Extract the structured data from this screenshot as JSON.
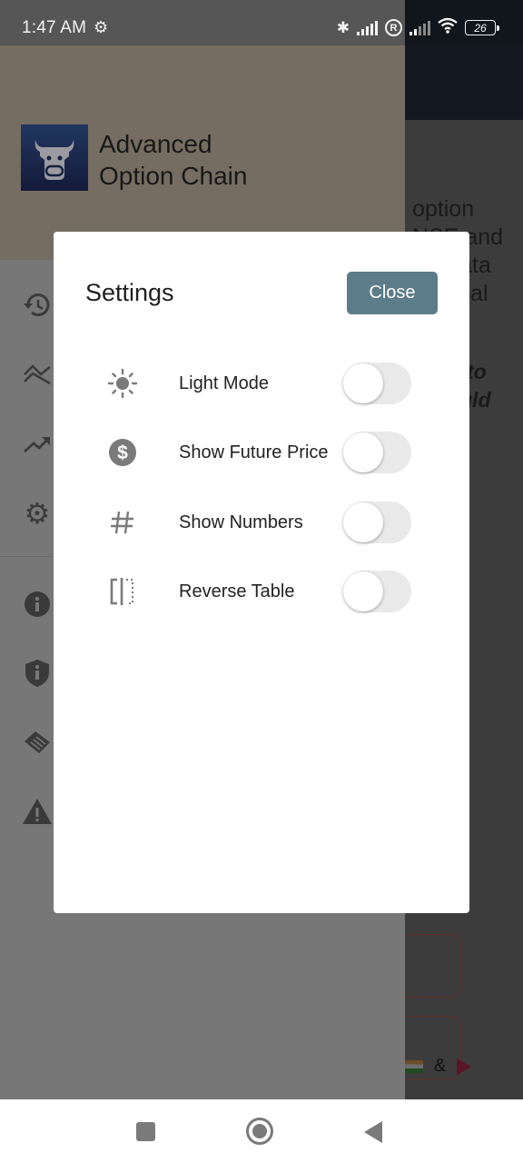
{
  "status_bar": {
    "time": "1:47 AM",
    "battery": "26",
    "icons": [
      "settings-gear-icon",
      "bluetooth-icon",
      "signal-icon",
      "registered-icon",
      "signal-icon-2",
      "wifi-icon",
      "battery-icon"
    ]
  },
  "drawer": {
    "app_name_line1": "Advanced",
    "app_name_line2": "Option Chain",
    "items": [
      {
        "icon": "history-icon"
      },
      {
        "icon": "chart-crossing-icon"
      },
      {
        "icon": "trending-up-icon"
      },
      {
        "icon": "settings-icon"
      },
      {
        "icon": "info-icon"
      },
      {
        "icon": "privacy-shield-icon"
      },
      {
        "icon": "handshake-icon"
      },
      {
        "icon": "warning-icon"
      }
    ]
  },
  "background_app": {
    "text_lines": [
      "option",
      "NSE and",
      "ata",
      "ical"
    ],
    "italic_lines": [
      "to",
      "uld"
    ],
    "footer_amp": "&"
  },
  "dialog": {
    "title": "Settings",
    "close_label": "Close",
    "settings": [
      {
        "icon": "sun-icon",
        "label": "Light Mode",
        "enabled": false
      },
      {
        "icon": "dollar-icon",
        "label": "Show Future Price",
        "enabled": false
      },
      {
        "icon": "hash-icon",
        "label": "Show Numbers",
        "enabled": false
      },
      {
        "icon": "reverse-table-icon",
        "label": "Reverse Table",
        "enabled": false
      }
    ]
  },
  "colors": {
    "close_button": "#5d7c89",
    "toggle_off_track": "#e9e9e9"
  }
}
